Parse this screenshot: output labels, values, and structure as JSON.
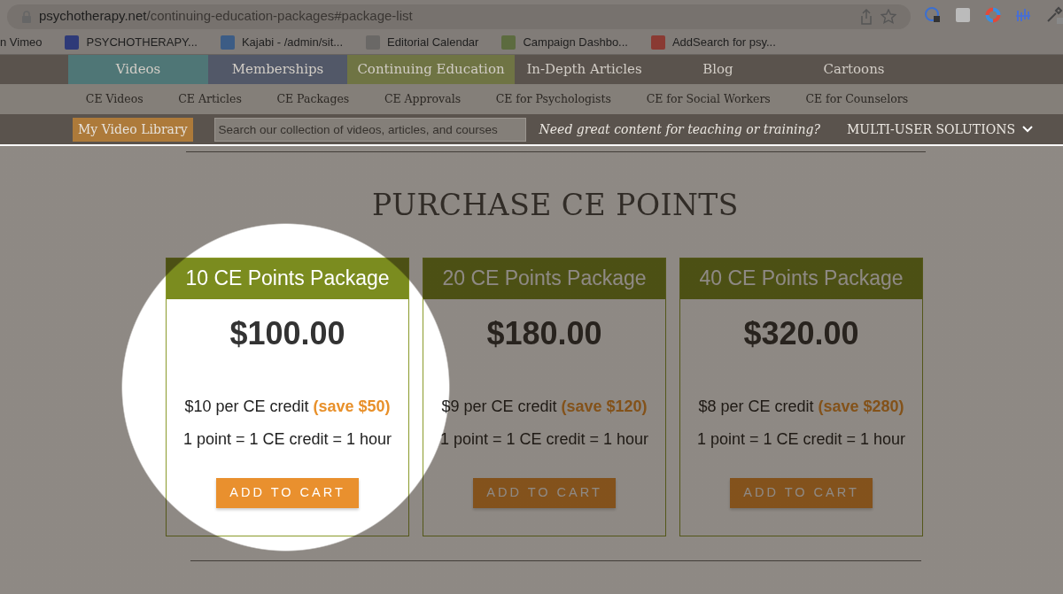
{
  "browser": {
    "url_host": "psychotherapy.net",
    "url_path": "/continuing-education-packages#package-list",
    "bookmarks": [
      {
        "label": "n Vimeo"
      },
      {
        "label": "PSYCHOTHERAPY..."
      },
      {
        "label": "Kajabi - /admin/sit..."
      },
      {
        "label": "Editorial Calendar"
      },
      {
        "label": "Campaign Dashbo..."
      },
      {
        "label": "AddSearch for psy..."
      }
    ]
  },
  "main_nav": [
    {
      "label": "Videos",
      "color": "#4f7676"
    },
    {
      "label": "Memberships",
      "color": "#525868"
    },
    {
      "label": "Continuing Education",
      "color": "#6f7444"
    },
    {
      "label": "In-Depth Articles"
    },
    {
      "label": "Blog"
    },
    {
      "label": "Cartoons"
    }
  ],
  "sub_nav": [
    {
      "label": "CE Videos"
    },
    {
      "label": "CE Articles"
    },
    {
      "label": "CE Packages"
    },
    {
      "label": "CE Approvals"
    },
    {
      "label": "CE for Psychologists"
    },
    {
      "label": "CE for Social Workers"
    },
    {
      "label": "CE for Counselors"
    }
  ],
  "toolbar": {
    "library_button": "My Video Library",
    "search": {
      "placeholder": "Search our collection of videos, articles, and courses"
    },
    "promo": "Need great content for teaching or training?",
    "menu": "MULTI-USER SOLUTIONS"
  },
  "heading": "PURCHASE CE POINTS",
  "packages": [
    {
      "title": "10 CE Points Package",
      "price": "$100.00",
      "rate": "$10 per CE credit",
      "savings": "(save $50)",
      "equation": "1 point = 1 CE credit = 1 hour",
      "button": "ADD TO CART",
      "spotlight": true
    },
    {
      "title": "20 CE Points Package",
      "price": "$180.00",
      "rate": "$9 per CE credit",
      "savings": "(save $120)",
      "equation": "1 point = 1 CE credit = 1 hour",
      "button": "ADD TO CART",
      "spotlight": false
    },
    {
      "title": "40 CE Points Package",
      "price": "$320.00",
      "rate": "$8 per CE credit",
      "savings": "(save $280)",
      "equation": "1 point = 1 CE credit = 1 hour",
      "button": "ADD TO CART",
      "spotlight": false
    }
  ]
}
